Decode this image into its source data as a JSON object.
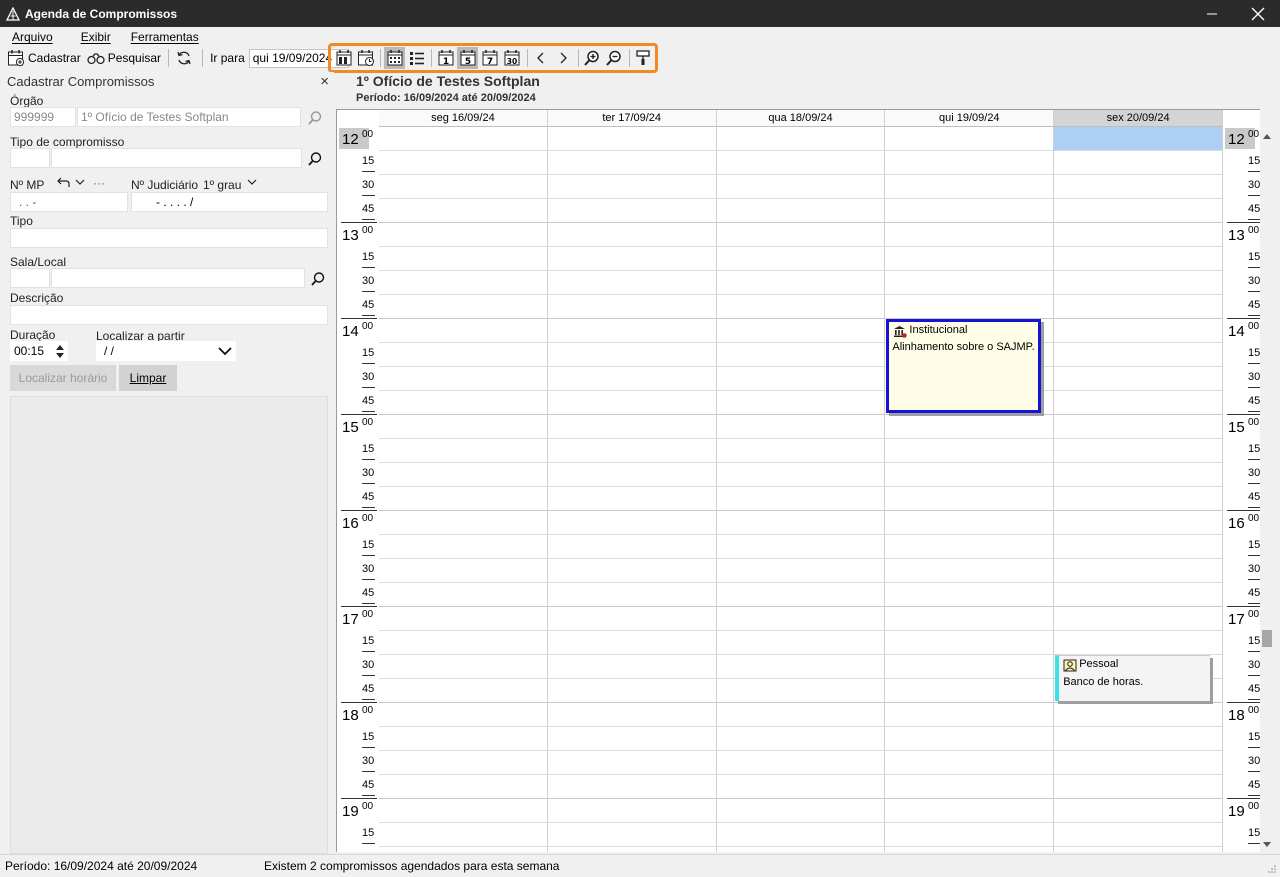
{
  "window": {
    "title": "Agenda de Compromissos"
  },
  "menu": {
    "items": [
      "Arquivo",
      "Exibir",
      "Ferramentas"
    ]
  },
  "toolbar": {
    "cadastrar": "Cadastrar",
    "pesquisar": "Pesquisar",
    "goto_label": "Ir para",
    "goto_date": "qui 19/09/2024"
  },
  "left_panel": {
    "title": "Cadastrar Compromissos",
    "orgao_label": "Órgão",
    "orgao_code": "999999",
    "orgao_name": "1º Ofício de Testes Softplan",
    "tipo_compromisso_label": "Tipo de compromisso",
    "nr_mp_label": "Nº MP",
    "nr_mp_mask": ". . -",
    "nr_judiciario_label": "Nº Judiciário",
    "grau": "1º grau",
    "nr_judiciario_mask": "- . . . . /",
    "tipo_label": "Tipo",
    "sala_label": "Sala/Local",
    "descricao_label": "Descrição",
    "duracao_label": "Duração",
    "duracao_value": "00:15",
    "localizar_label": "Localizar a partir",
    "localizar_value": "/ /",
    "btn_localizar": "Localizar horário",
    "btn_limpar": "Limpar"
  },
  "calendar": {
    "org_title": "1º Ofício de Testes Softplan",
    "period": "Período: 16/09/2024 até 20/09/2024",
    "days": [
      "seg 16/09/24",
      "ter 17/09/24",
      "qua 18/09/24",
      "qui 19/09/24",
      "sex 20/09/24"
    ],
    "today_index": 4,
    "hours": [
      "12",
      "13",
      "14",
      "15",
      "16",
      "17",
      "18",
      "19"
    ],
    "hour_sup": "00",
    "minutes": [
      "15",
      "30",
      "45"
    ],
    "events": [
      {
        "category": "Institucional",
        "description": "Alinhamento sobre o SAJMP.",
        "day_index": 3,
        "start": "14:00",
        "end": "15:00",
        "accent": "#1414d2",
        "bg": "#fffde6",
        "icon": "building-icon"
      },
      {
        "category": "Pessoal",
        "description": "Banco de horas.",
        "day_index": 4,
        "start": "17:30",
        "end": "18:00",
        "accent": "#39e1e8",
        "bg": "#f4f4f4",
        "icon": "person-icon"
      }
    ]
  },
  "status": {
    "period": "Período: 16/09/2024 até 20/09/2024",
    "message": "Existem 2 compromissos agendados para esta semana"
  }
}
